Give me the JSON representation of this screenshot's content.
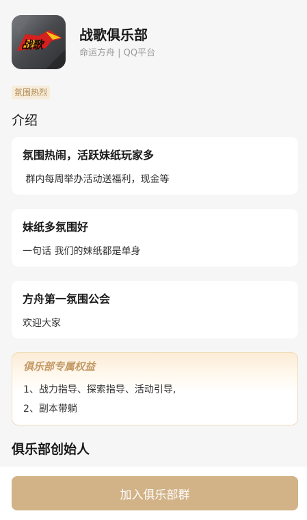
{
  "header": {
    "club_name": "战歌俱乐部",
    "subtitle": "命运方舟 | QQ平台",
    "logo_text": "战歌"
  },
  "tag": "氛围热烈",
  "intro": {
    "title": "介绍",
    "cards": [
      {
        "title": "氛围热闹，活跃妹纸玩家多",
        "desc": " 群内每周举办活动送福利，现金等"
      },
      {
        "title": "妹纸多氛围好",
        "desc": "一句话 我们的妹纸都是单身"
      },
      {
        "title": "方舟第一氛围公会",
        "desc": "欢迎大家"
      }
    ]
  },
  "benefits": {
    "title": "俱乐部专属权益",
    "lines": [
      "1、战力指导、探索指导、活动引导,",
      "2、副本带躺"
    ]
  },
  "founder": {
    "title": "俱乐部创始人"
  },
  "join_button": "加入俱乐部群",
  "colors": {
    "accent": "#d2b287",
    "tag_bg": "#f7ecd9",
    "tag_text": "#b38a55",
    "logo_red": "#d4201f",
    "logo_yellow": "#f5c21a"
  }
}
